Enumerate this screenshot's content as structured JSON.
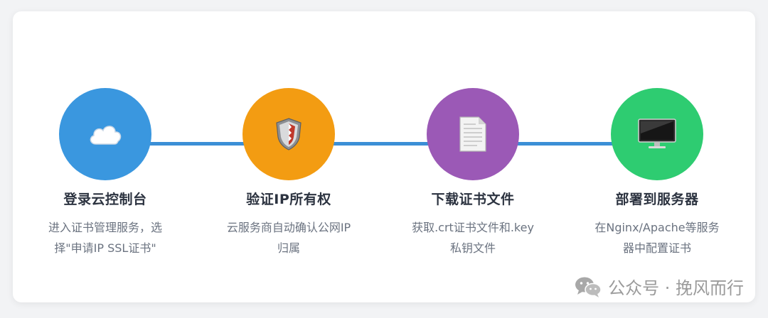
{
  "steps": [
    {
      "title": "登录云控制台",
      "desc": "进入证书管理服务，选择\"申请IP SSL证书\"",
      "color": "#3a97df",
      "icon": "cloud-icon"
    },
    {
      "title": "验证IP所有权",
      "desc": "云服务商自动确认公网IP归属",
      "color": "#f39c12",
      "icon": "shield-icon"
    },
    {
      "title": "下载证书文件",
      "desc": "获取.crt证书文件和.key私钥文件",
      "color": "#9b59b6",
      "icon": "document-icon"
    },
    {
      "title": "部署到服务器",
      "desc": "在Nginx/Apache等服务器中配置证书",
      "color": "#2ecc71",
      "icon": "monitor-icon"
    }
  ],
  "connector_color": "#3b8fd6",
  "watermark": {
    "text": "公众号 · 挽风而行",
    "icon": "wechat-icon"
  }
}
